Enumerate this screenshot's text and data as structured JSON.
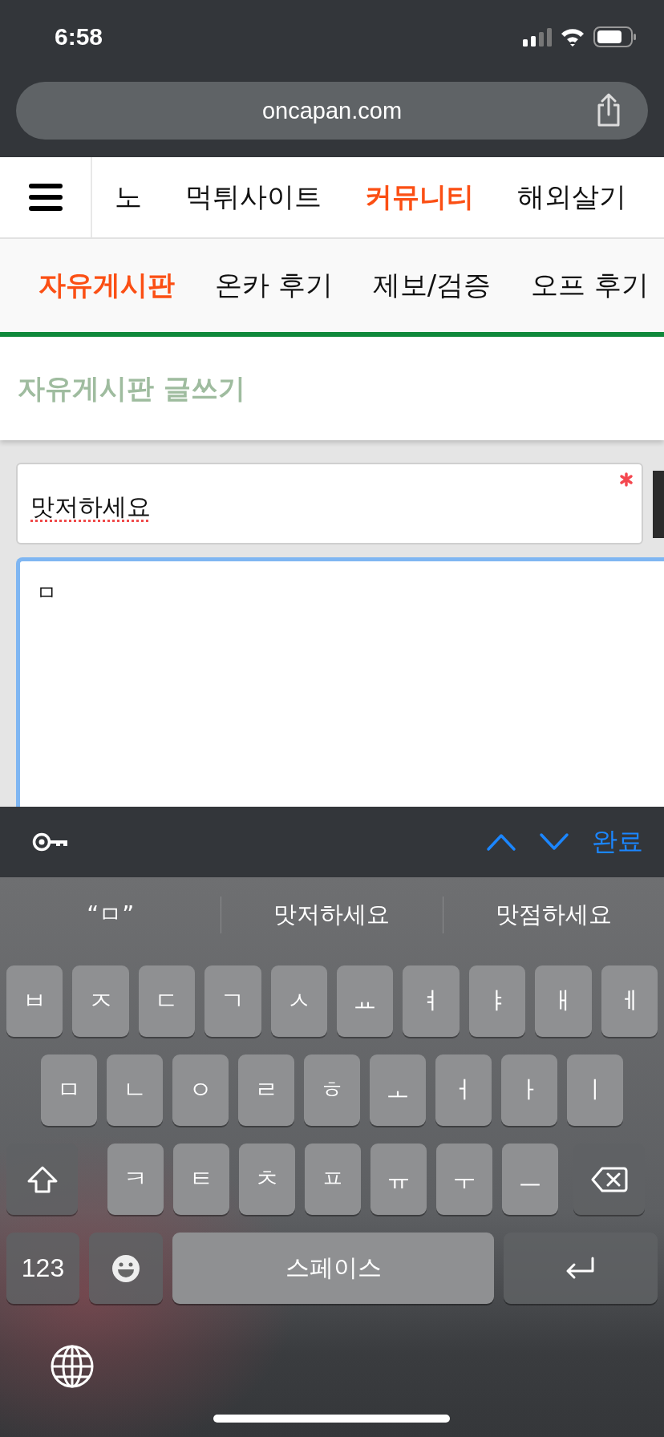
{
  "status_bar": {
    "time": "6:58"
  },
  "browser": {
    "url": "oncapan.com"
  },
  "main_nav": [
    {
      "label": "노",
      "selected": false
    },
    {
      "label": "먹튀사이트",
      "selected": false
    },
    {
      "label": "커뮤니티",
      "selected": true
    },
    {
      "label": "해외살기",
      "selected": false
    }
  ],
  "sub_nav": [
    {
      "label": "자유게시판",
      "selected": true
    },
    {
      "label": "온카 후기",
      "selected": false
    },
    {
      "label": "제보/검증",
      "selected": false
    },
    {
      "label": "오프 후기",
      "selected": false
    }
  ],
  "page_title": "자유게시판 글쓰기",
  "form": {
    "title_value": "맛저하세요",
    "title_misspelled": true,
    "required": true,
    "body_value": "ㅁ",
    "body_focused": true
  },
  "accessory_bar": {
    "done": "완료"
  },
  "suggestions": [
    "“ㅁ”",
    "맛저하세요",
    "맛점하세요"
  ],
  "keyboard_rows": [
    [
      {
        "kind": "letter",
        "label": "ㅂ"
      },
      {
        "kind": "letter",
        "label": "ㅈ"
      },
      {
        "kind": "letter",
        "label": "ㄷ"
      },
      {
        "kind": "letter",
        "label": "ㄱ"
      },
      {
        "kind": "letter",
        "label": "ㅅ"
      },
      {
        "kind": "letter",
        "label": "ㅛ"
      },
      {
        "kind": "letter",
        "label": "ㅕ"
      },
      {
        "kind": "letter",
        "label": "ㅑ"
      },
      {
        "kind": "letter",
        "label": "ㅐ"
      },
      {
        "kind": "letter",
        "label": "ㅔ"
      }
    ],
    [
      {
        "kind": "letter",
        "label": "ㅁ"
      },
      {
        "kind": "letter",
        "label": "ㄴ"
      },
      {
        "kind": "letter",
        "label": "ㅇ"
      },
      {
        "kind": "letter",
        "label": "ㄹ"
      },
      {
        "kind": "letter",
        "label": "ㅎ"
      },
      {
        "kind": "letter",
        "label": "ㅗ"
      },
      {
        "kind": "letter",
        "label": "ㅓ"
      },
      {
        "kind": "letter",
        "label": "ㅏ"
      },
      {
        "kind": "letter",
        "label": "ㅣ"
      }
    ],
    [
      {
        "kind": "shift"
      },
      {
        "kind": "letter",
        "label": "ㅋ"
      },
      {
        "kind": "letter",
        "label": "ㅌ"
      },
      {
        "kind": "letter",
        "label": "ㅊ"
      },
      {
        "kind": "letter",
        "label": "ㅍ"
      },
      {
        "kind": "letter",
        "label": "ㅠ"
      },
      {
        "kind": "letter",
        "label": "ㅜ"
      },
      {
        "kind": "letter",
        "label": "ㅡ"
      },
      {
        "kind": "backspace"
      }
    ],
    [
      {
        "kind": "numbers",
        "label": "123"
      },
      {
        "kind": "emoji"
      },
      {
        "kind": "space",
        "label": "스페이스"
      },
      {
        "kind": "return"
      }
    ]
  ]
}
